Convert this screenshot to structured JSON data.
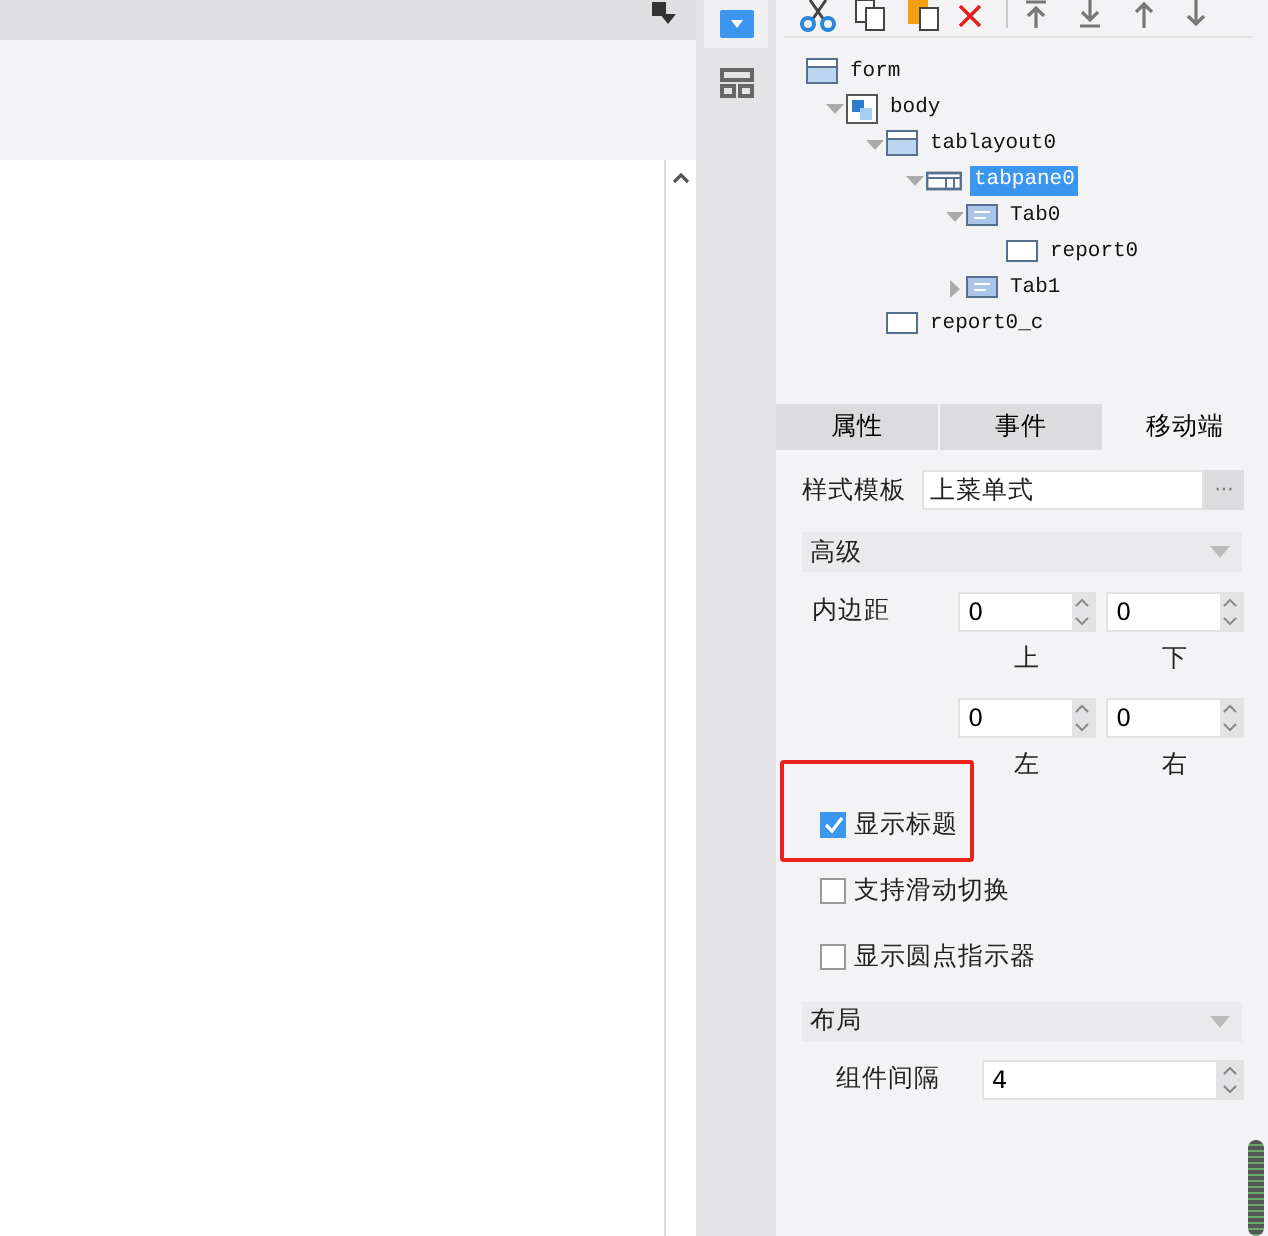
{
  "tree": [
    {
      "label": "form",
      "kind": "layout",
      "selected": false,
      "children": [
        {
          "label": "body",
          "kind": "body",
          "selected": false,
          "expanded": true,
          "children": [
            {
              "label": "tablayout0",
              "kind": "layout",
              "selected": false,
              "expanded": true,
              "children": [
                {
                  "label": "tabpane0",
                  "kind": "tabpane",
                  "selected": true,
                  "expanded": true,
                  "children": [
                    {
                      "label": "Tab0",
                      "kind": "tab",
                      "selected": false,
                      "expanded": true,
                      "children": [
                        {
                          "label": "report0",
                          "kind": "report",
                          "selected": false
                        }
                      ]
                    },
                    {
                      "label": "Tab1",
                      "kind": "tab",
                      "selected": false,
                      "expanded": false
                    }
                  ]
                }
              ]
            },
            {
              "label": "report0_c",
              "kind": "report",
              "selected": false
            }
          ]
        }
      ]
    }
  ],
  "tabs": [
    {
      "label": "属性",
      "selected": false
    },
    {
      "label": "事件",
      "selected": false
    },
    {
      "label": "移动端",
      "selected": true
    }
  ],
  "style_template": {
    "label": "样式模板",
    "value": "上菜单式",
    "button": "···"
  },
  "advanced": {
    "title": "高级",
    "padding_label": "内边距",
    "padding": [
      {
        "value": "0",
        "label": "上"
      },
      {
        "value": "0",
        "label": "下"
      },
      {
        "value": "0",
        "label": "左"
      },
      {
        "value": "0",
        "label": "右"
      }
    ]
  },
  "checkboxes": [
    {
      "label": "显示标题",
      "checked": true,
      "highlighted": true
    },
    {
      "label": "支持滑动切换",
      "checked": false,
      "highlighted": false
    },
    {
      "label": "显示圆点指示器",
      "checked": false,
      "highlighted": false
    }
  ],
  "layout": {
    "title": "布局",
    "spacing_label": "组件间隔",
    "spacing_value": "4"
  }
}
